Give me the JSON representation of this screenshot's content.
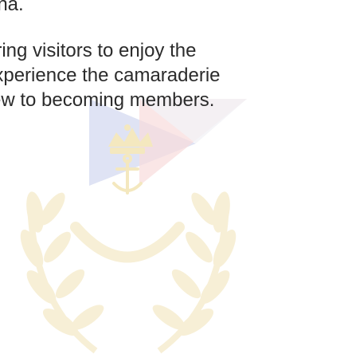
{
  "paragraph": {
    "line_1": "rina.",
    "line_2": "bring visitors to enjoy the",
    "line_3": "experience the camaraderie",
    "line_4": "ew to becoming members."
  },
  "watermark": {
    "icon": "club-crest-watermark-icon",
    "colors": {
      "wreath": "#f7efd6",
      "flag_red": "#f8dcdc",
      "flag_blue": "#dfe3f4",
      "gold": "#f4e8bf"
    }
  }
}
